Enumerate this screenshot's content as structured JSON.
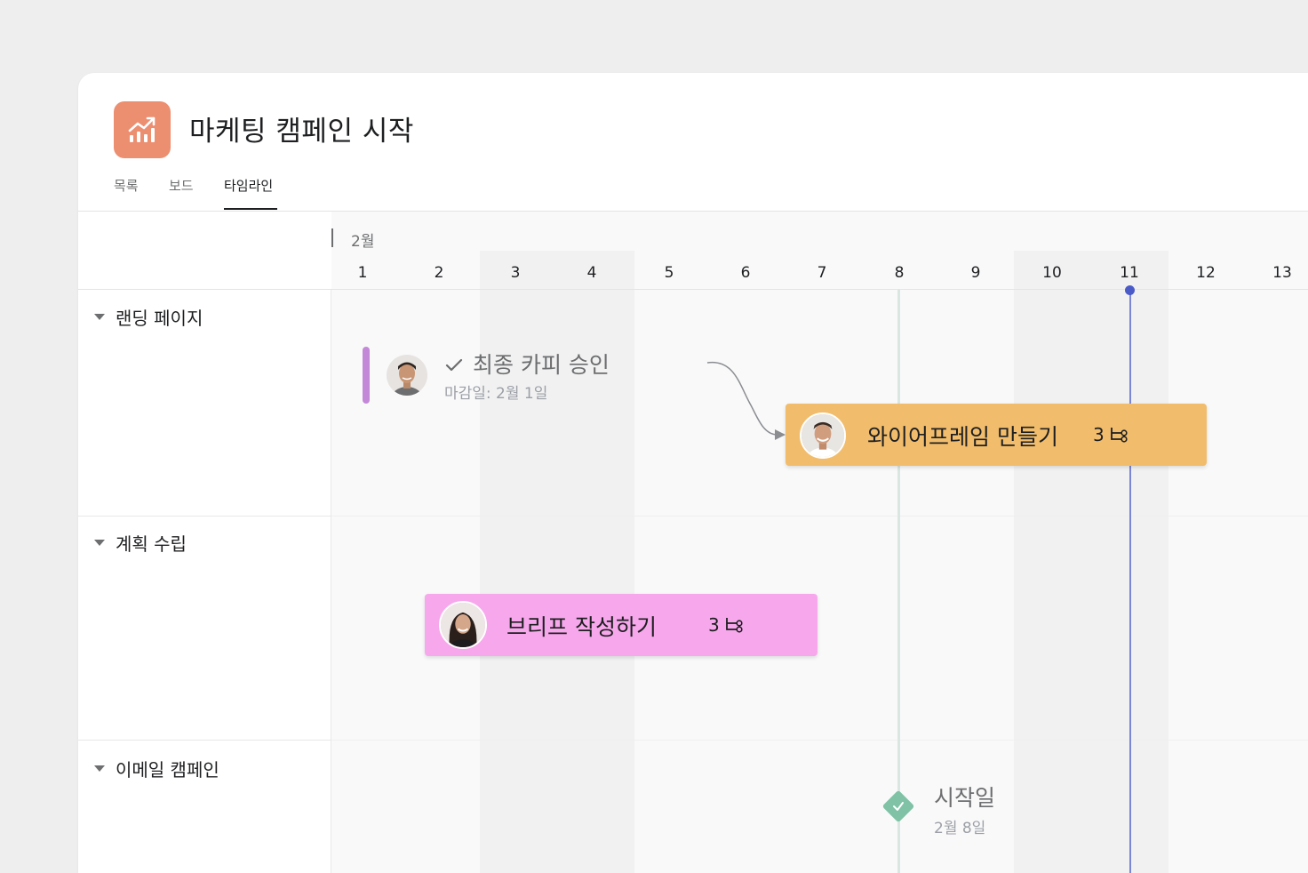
{
  "project": {
    "title": "마케팅 캠페인 시작",
    "icon": "trending-up-chart-icon",
    "icon_color": "#ec8e70"
  },
  "tabs": [
    {
      "label": "목록",
      "active": false
    },
    {
      "label": "보드",
      "active": false
    },
    {
      "label": "타임라인",
      "active": true
    }
  ],
  "timeline": {
    "month": "2월",
    "days": [
      "1",
      "2",
      "3",
      "4",
      "5",
      "6",
      "7",
      "8",
      "9",
      "10",
      "11",
      "12",
      "13"
    ],
    "today": "11"
  },
  "sections": [
    {
      "name": "랜딩 페이지"
    },
    {
      "name": "계획 수립"
    },
    {
      "name": "이메일 캠페인"
    }
  ],
  "tasks": {
    "completed": {
      "title": "최종 카피 승인",
      "due": "마감일: 2월 1일",
      "status_icon": "check-icon"
    },
    "wireframe": {
      "title": "와이어프레임 만들기",
      "subtasks": "3",
      "color": "#f1bd6c"
    },
    "brief": {
      "title": "브리프 작성하기",
      "subtasks": "3",
      "color": "#f7a8ec"
    }
  },
  "milestone": {
    "title": "시작일",
    "date": "2월 8일",
    "color": "#7fc2a5"
  },
  "colors": {
    "today_line": "#4a5bc8",
    "done_accent": "#c488d9"
  }
}
